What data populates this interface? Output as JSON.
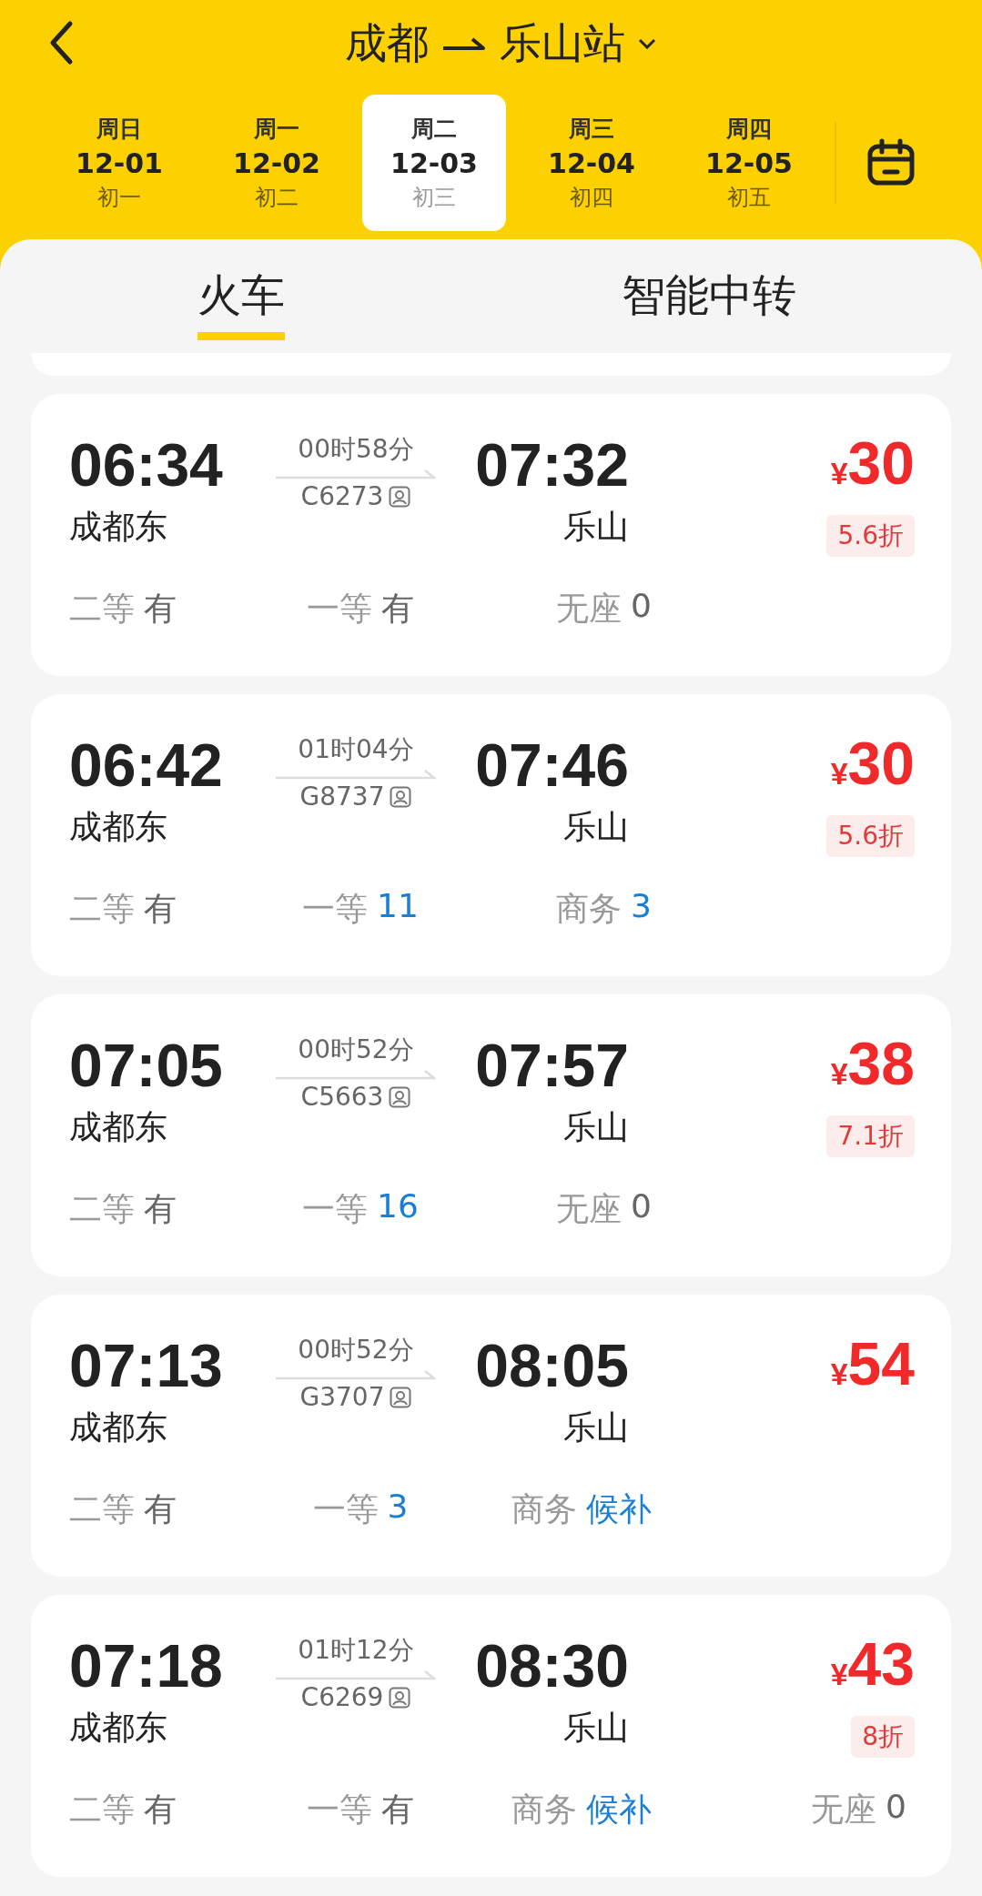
{
  "header": {
    "from": "成都",
    "to": "乐山站"
  },
  "dates": [
    {
      "weekday": "周日",
      "date": "12-01",
      "lunar": "初一",
      "selected": false
    },
    {
      "weekday": "周一",
      "date": "12-02",
      "lunar": "初二",
      "selected": false
    },
    {
      "weekday": "周二",
      "date": "12-03",
      "lunar": "初三",
      "selected": true
    },
    {
      "weekday": "周三",
      "date": "12-04",
      "lunar": "初四",
      "selected": false
    },
    {
      "weekday": "周四",
      "date": "12-05",
      "lunar": "初五",
      "selected": false
    }
  ],
  "tabs": [
    {
      "label": "火车",
      "selected": true
    },
    {
      "label": "智能中转",
      "selected": false
    }
  ],
  "trains": [
    {
      "depart": "06:34",
      "from": "成都东",
      "duration": "00时58分",
      "number": "C6273",
      "arrive": "07:32",
      "to": "乐山",
      "currency": "¥",
      "price": "30",
      "discount": "5.6折",
      "seats": [
        {
          "class": "二等",
          "value": "有",
          "kind": "plain"
        },
        {
          "class": "一等",
          "value": "有",
          "kind": "plain"
        },
        {
          "class": "无座",
          "value": "0",
          "kind": "plain"
        }
      ]
    },
    {
      "depart": "06:42",
      "from": "成都东",
      "duration": "01时04分",
      "number": "G8737",
      "arrive": "07:46",
      "to": "乐山",
      "currency": "¥",
      "price": "30",
      "discount": "5.6折",
      "seats": [
        {
          "class": "二等",
          "value": "有",
          "kind": "plain"
        },
        {
          "class": "一等",
          "value": "11",
          "kind": "accent"
        },
        {
          "class": "商务",
          "value": "3",
          "kind": "accent"
        }
      ]
    },
    {
      "depart": "07:05",
      "from": "成都东",
      "duration": "00时52分",
      "number": "C5663",
      "arrive": "07:57",
      "to": "乐山",
      "currency": "¥",
      "price": "38",
      "discount": "7.1折",
      "seats": [
        {
          "class": "二等",
          "value": "有",
          "kind": "plain"
        },
        {
          "class": "一等",
          "value": "16",
          "kind": "accent"
        },
        {
          "class": "无座",
          "value": "0",
          "kind": "plain"
        }
      ]
    },
    {
      "depart": "07:13",
      "from": "成都东",
      "duration": "00时52分",
      "number": "G3707",
      "arrive": "08:05",
      "to": "乐山",
      "currency": "¥",
      "price": "54",
      "seats": [
        {
          "class": "二等",
          "value": "有",
          "kind": "plain"
        },
        {
          "class": "一等",
          "value": "3",
          "kind": "accent"
        },
        {
          "class": "商务",
          "value": "候补",
          "kind": "accent"
        }
      ]
    },
    {
      "depart": "07:18",
      "from": "成都东",
      "duration": "01时12分",
      "number": "C6269",
      "arrive": "08:30",
      "to": "乐山",
      "currency": "¥",
      "price": "43",
      "discount": "8折",
      "seats": [
        {
          "class": "二等",
          "value": "有",
          "kind": "plain"
        },
        {
          "class": "一等",
          "value": "有",
          "kind": "plain"
        },
        {
          "class": "商务",
          "value": "候补",
          "kind": "accent"
        },
        {
          "class": "无座",
          "value": "0",
          "kind": "plain"
        }
      ]
    }
  ]
}
